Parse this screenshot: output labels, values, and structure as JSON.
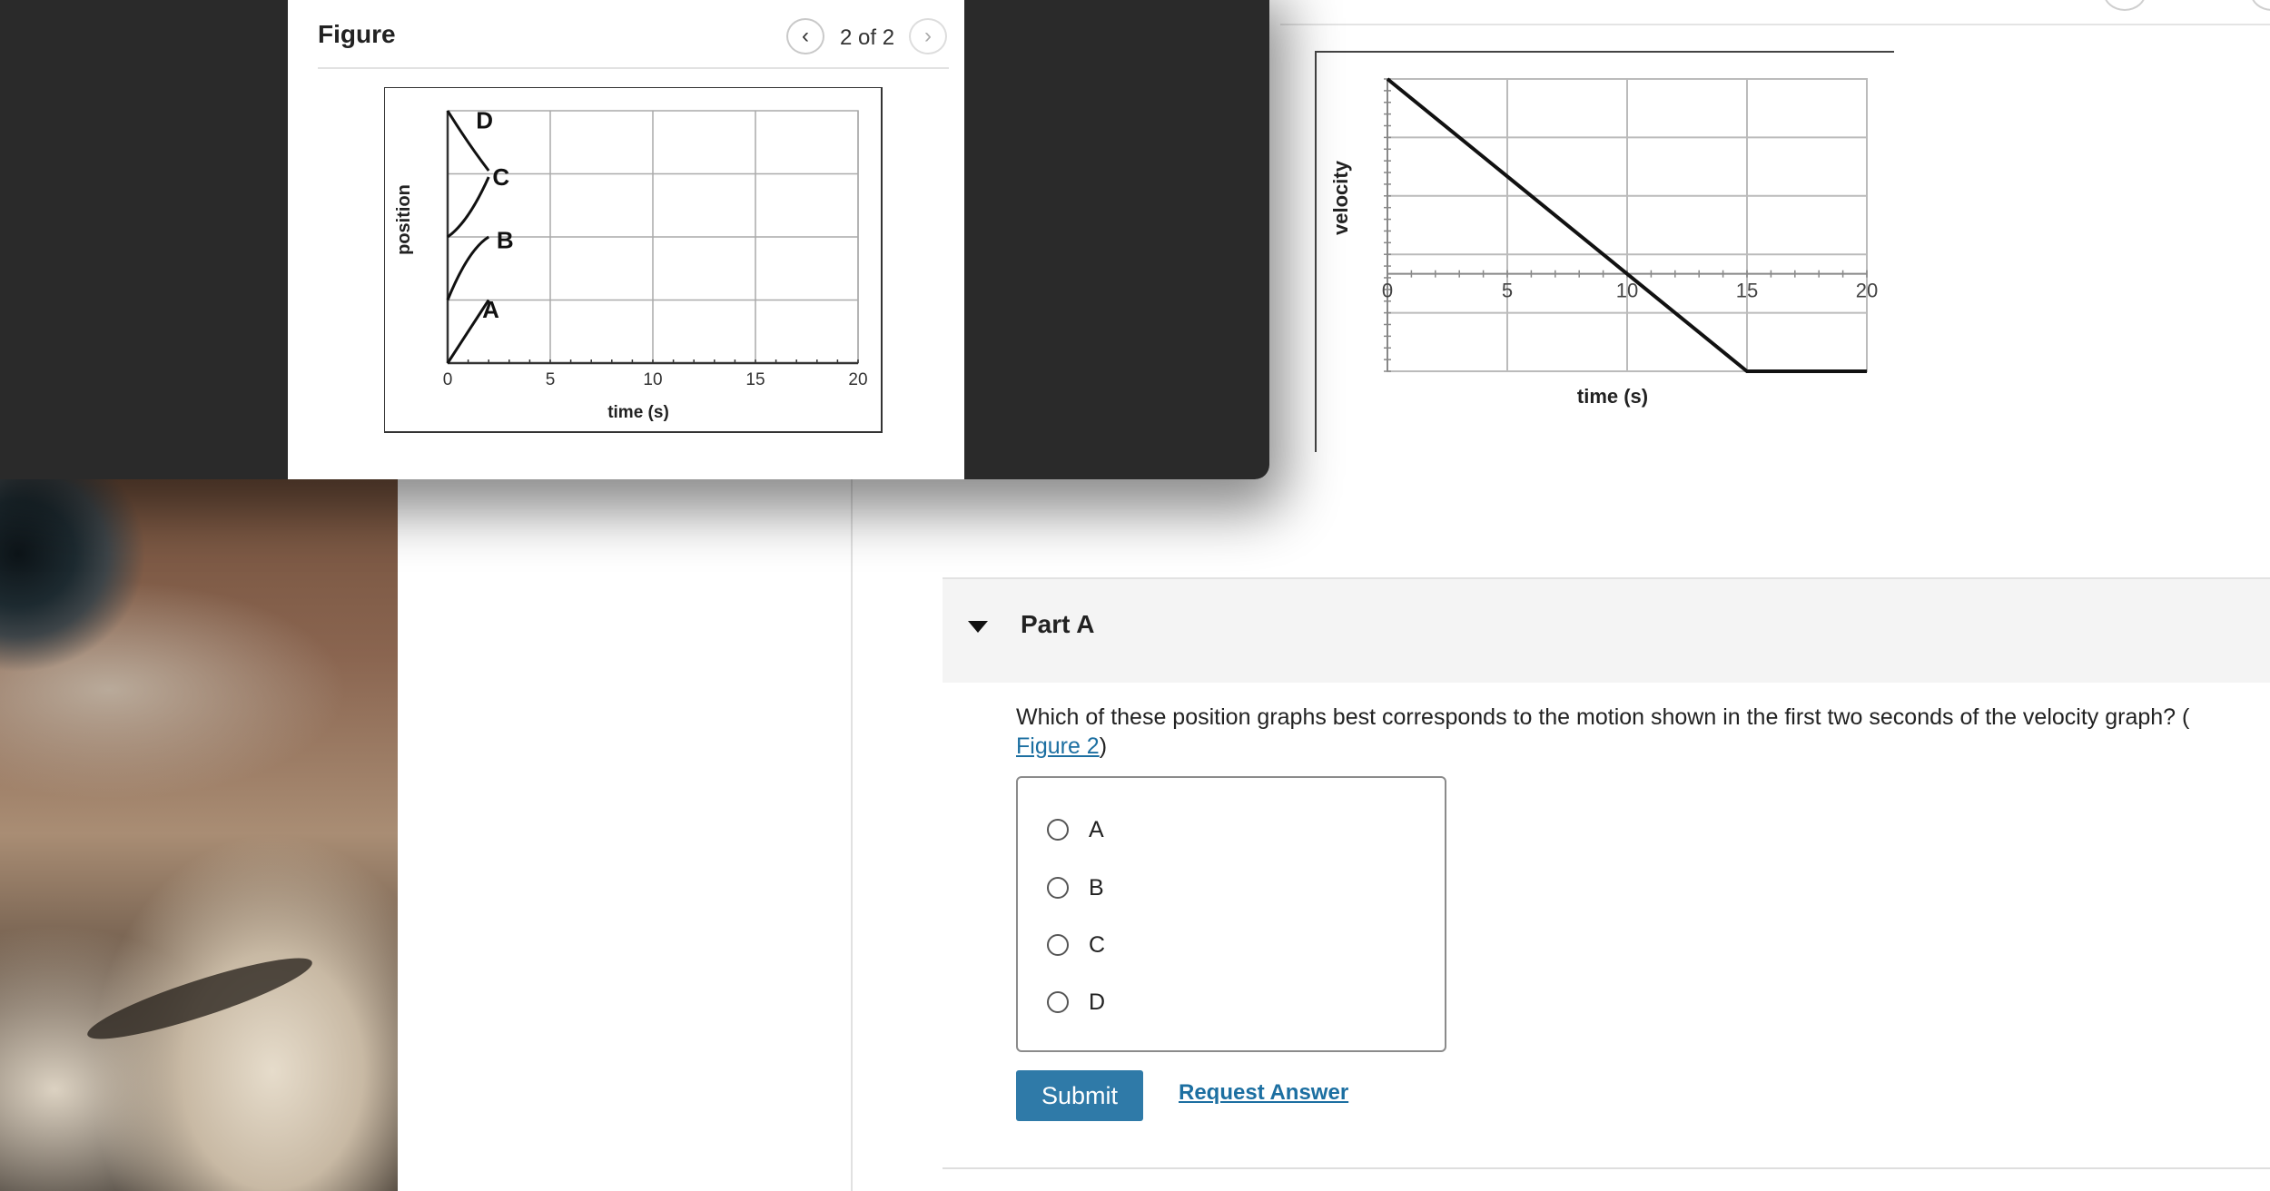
{
  "modal": {
    "title": "Figure",
    "page_count": "2 of 2",
    "prev_icon": "chevron-left-icon",
    "next_icon": "chevron-right-icon"
  },
  "position_figure": {
    "ylabel": "position",
    "xlabel": "time (s)",
    "x_ticks": [
      "0",
      "5",
      "10",
      "15",
      "20"
    ],
    "curve_labels": [
      "D",
      "C",
      "B",
      "A"
    ]
  },
  "velocity_figure": {
    "ylabel": "velocity",
    "xlabel": "time (s)",
    "x_ticks": [
      "0",
      "5",
      "10",
      "15",
      "20"
    ]
  },
  "chart_data": [
    {
      "type": "line",
      "ylabel": "position",
      "xlabel": "time (s)",
      "xlim": [
        0,
        20
      ],
      "x_ticks": [
        0,
        5,
        10,
        15,
        20
      ],
      "series": [
        {
          "name": "D",
          "x": [
            0,
            1,
            2
          ],
          "y": [
            4.0,
            3.5,
            3.05
          ]
        },
        {
          "name": "C",
          "x": [
            0,
            1,
            2
          ],
          "y": [
            2.0,
            2.35,
            2.95
          ]
        },
        {
          "name": "B",
          "x": [
            0,
            1,
            2
          ],
          "y": [
            1.0,
            1.65,
            2.0
          ]
        },
        {
          "name": "A",
          "x": [
            0,
            2
          ],
          "y": [
            0.0,
            1.0
          ]
        }
      ]
    },
    {
      "type": "line",
      "ylabel": "velocity",
      "xlabel": "time (s)",
      "xlim": [
        0,
        20
      ],
      "x_ticks": [
        0,
        5,
        10,
        15,
        20
      ],
      "series": [
        {
          "x": [
            0,
            10,
            15,
            20
          ],
          "y": [
            3,
            0,
            -1.5,
            -1.5
          ]
        }
      ]
    }
  ],
  "part": {
    "title": "Part A",
    "question_text": "Which of these position graphs best corresponds to the motion shown in the first two seconds of the velocity graph? (",
    "figure_link": "Figure 2",
    "question_close": ")"
  },
  "choices": [
    "A",
    "B",
    "C",
    "D"
  ],
  "actions": {
    "submit_label": "Submit",
    "request_label": "Request Answer"
  },
  "colors": {
    "submit_bg": "#2f7aa8",
    "link": "#1c6fa1",
    "modal_frame": "#2a2a2a"
  }
}
